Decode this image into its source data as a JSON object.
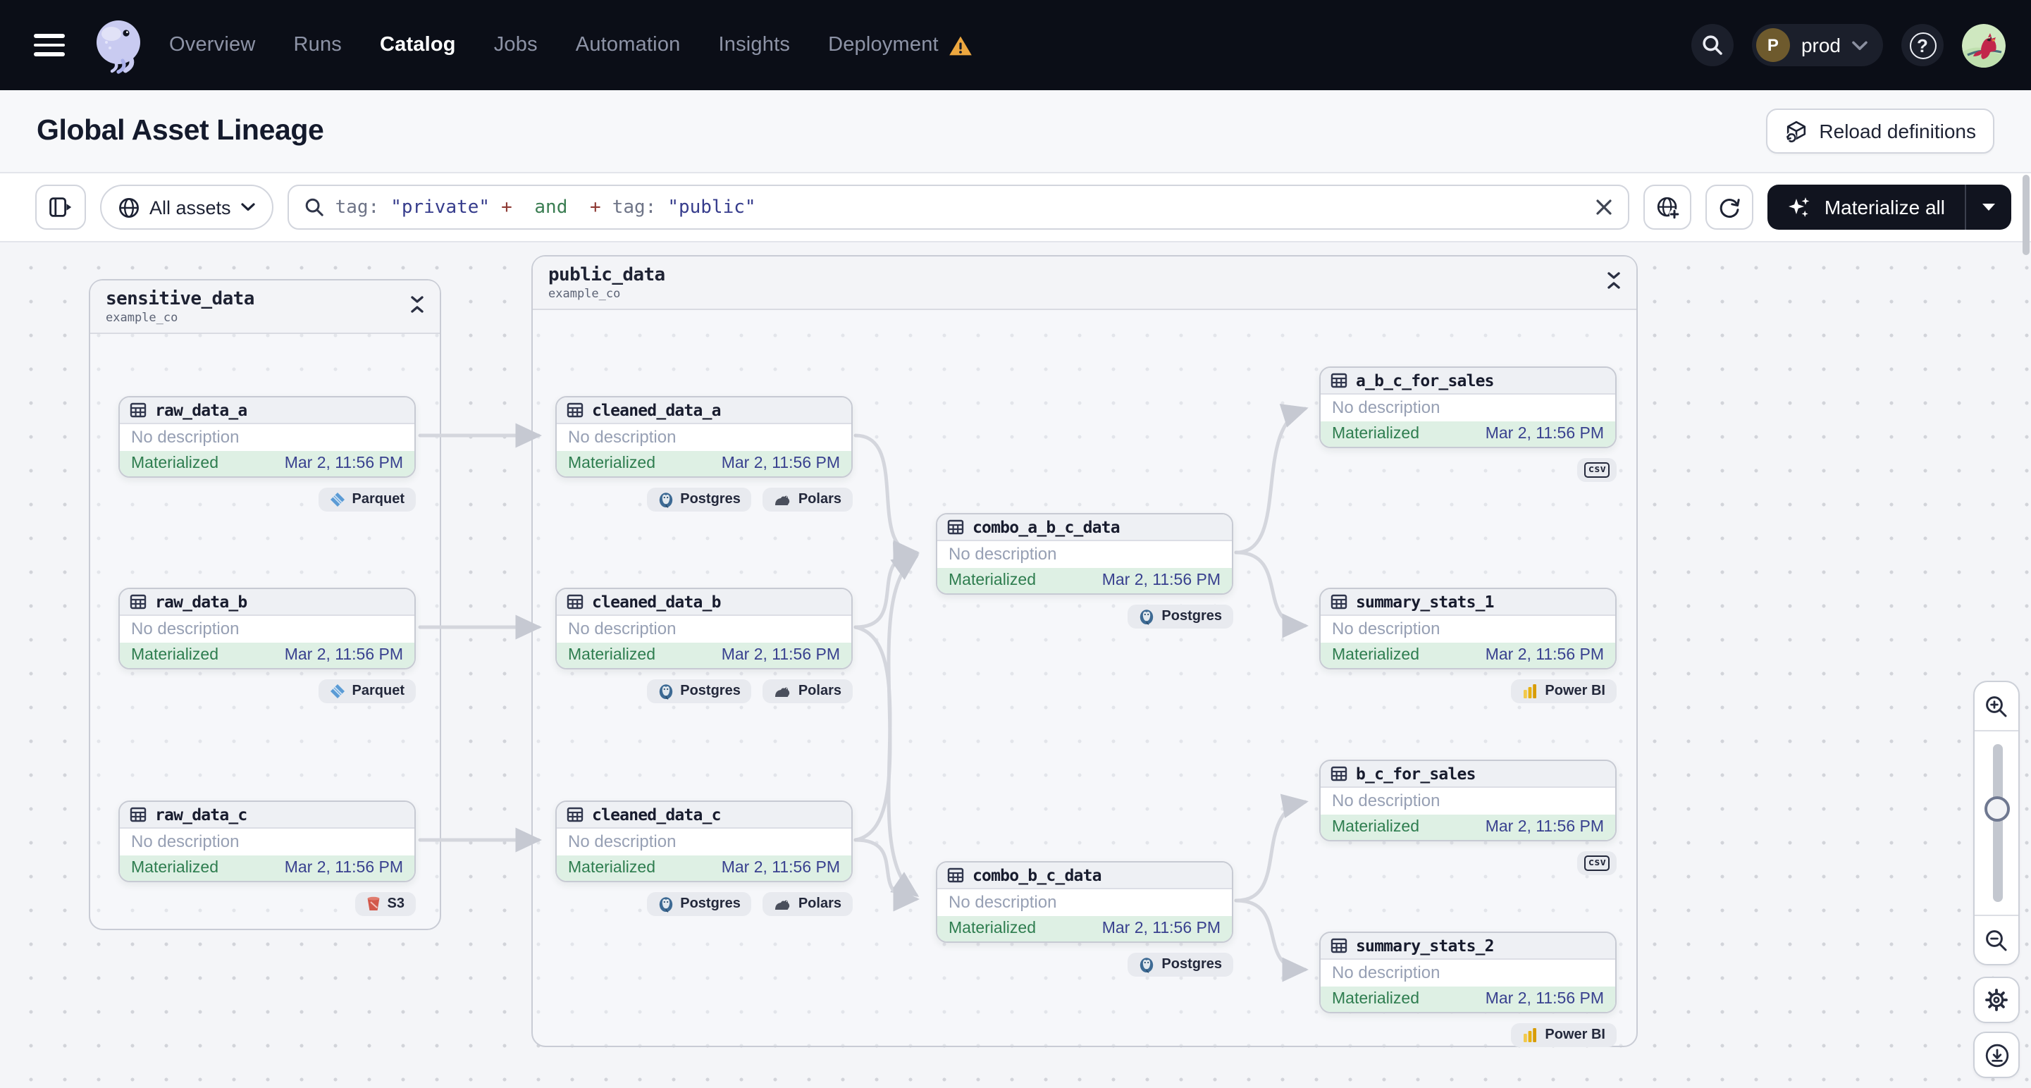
{
  "nav": {
    "items": [
      {
        "label": "Overview"
      },
      {
        "label": "Runs"
      },
      {
        "label": "Catalog",
        "active": true
      },
      {
        "label": "Jobs"
      },
      {
        "label": "Automation"
      },
      {
        "label": "Insights"
      },
      {
        "label": "Deployment",
        "warning": true
      }
    ],
    "environment": "prod",
    "environment_initial": "P"
  },
  "header": {
    "title": "Global Asset Lineage",
    "reload_button": "Reload definitions"
  },
  "filter_bar": {
    "scope_label": "All assets",
    "query": {
      "tokens": [
        {
          "text": "tag:",
          "type": "field"
        },
        {
          "text": "\"private\"",
          "type": "string"
        },
        {
          "text": "+",
          "type": "operator"
        },
        {
          "text": " and ",
          "type": "keyword"
        },
        {
          "text": "+",
          "type": "operator"
        },
        {
          "text": "tag:",
          "type": "field"
        },
        {
          "text": "\"public\"",
          "type": "string"
        }
      ]
    },
    "materialize_button": "Materialize all"
  },
  "graph": {
    "groups": [
      {
        "name": "sensitive_data",
        "repo": "example_co",
        "assets": [
          {
            "name": "raw_data_a",
            "description": "No description",
            "status": "Materialized",
            "materialized_at": "Mar 2, 11:56 PM",
            "badges": [
              {
                "label": "Parquet",
                "icon": "parquet-icon"
              }
            ]
          },
          {
            "name": "raw_data_b",
            "description": "No description",
            "status": "Materialized",
            "materialized_at": "Mar 2, 11:56 PM",
            "badges": [
              {
                "label": "Parquet",
                "icon": "parquet-icon"
              }
            ]
          },
          {
            "name": "raw_data_c",
            "description": "No description",
            "status": "Materialized",
            "materialized_at": "Mar 2, 11:56 PM",
            "badges": [
              {
                "label": "S3",
                "icon": "s3-icon"
              }
            ]
          }
        ]
      },
      {
        "name": "public_data",
        "repo": "example_co",
        "assets": [
          {
            "name": "cleaned_data_a",
            "description": "No description",
            "status": "Materialized",
            "materialized_at": "Mar 2, 11:56 PM",
            "badges": [
              {
                "label": "Postgres",
                "icon": "postgres-icon"
              },
              {
                "label": "Polars",
                "icon": "polars-icon"
              }
            ]
          },
          {
            "name": "cleaned_data_b",
            "description": "No description",
            "status": "Materialized",
            "materialized_at": "Mar 2, 11:56 PM",
            "badges": [
              {
                "label": "Postgres",
                "icon": "postgres-icon"
              },
              {
                "label": "Polars",
                "icon": "polars-icon"
              }
            ]
          },
          {
            "name": "cleaned_data_c",
            "description": "No description",
            "status": "Materialized",
            "materialized_at": "Mar 2, 11:56 PM",
            "badges": [
              {
                "label": "Postgres",
                "icon": "postgres-icon"
              },
              {
                "label": "Polars",
                "icon": "polars-icon"
              }
            ]
          },
          {
            "name": "combo_a_b_c_data",
            "description": "No description",
            "status": "Materialized",
            "materialized_at": "Mar 2, 11:56 PM",
            "badges": [
              {
                "label": "Postgres",
                "icon": "postgres-icon"
              }
            ]
          },
          {
            "name": "combo_b_c_data",
            "description": "No description",
            "status": "Materialized",
            "materialized_at": "Mar 2, 11:56 PM",
            "badges": [
              {
                "label": "Postgres",
                "icon": "postgres-icon"
              }
            ]
          },
          {
            "name": "a_b_c_for_sales",
            "description": "No description",
            "status": "Materialized",
            "materialized_at": "Mar 2, 11:56 PM",
            "badges": [
              {
                "label": "csv",
                "icon": "csv-icon"
              }
            ]
          },
          {
            "name": "summary_stats_1",
            "description": "No description",
            "status": "Materialized",
            "materialized_at": "Mar 2, 11:56 PM",
            "badges": [
              {
                "label": "Power BI",
                "icon": "powerbi-icon"
              }
            ]
          },
          {
            "name": "b_c_for_sales",
            "description": "No description",
            "status": "Materialized",
            "materialized_at": "Mar 2, 11:56 PM",
            "badges": [
              {
                "label": "csv",
                "icon": "csv-icon"
              }
            ]
          },
          {
            "name": "summary_stats_2",
            "description": "No description",
            "status": "Materialized",
            "materialized_at": "Mar 2, 11:56 PM",
            "badges": [
              {
                "label": "Power BI",
                "icon": "powerbi-icon"
              }
            ]
          }
        ]
      }
    ],
    "edges": [
      [
        "raw_data_a",
        "cleaned_data_a"
      ],
      [
        "raw_data_b",
        "cleaned_data_b"
      ],
      [
        "raw_data_c",
        "cleaned_data_c"
      ],
      [
        "cleaned_data_a",
        "combo_a_b_c_data"
      ],
      [
        "cleaned_data_b",
        "combo_a_b_c_data"
      ],
      [
        "cleaned_data_c",
        "combo_a_b_c_data"
      ],
      [
        "cleaned_data_b",
        "combo_b_c_data"
      ],
      [
        "cleaned_data_c",
        "combo_b_c_data"
      ],
      [
        "combo_a_b_c_data",
        "a_b_c_for_sales"
      ],
      [
        "combo_a_b_c_data",
        "summary_stats_1"
      ],
      [
        "combo_b_c_data",
        "b_c_for_sales"
      ],
      [
        "combo_b_c_data",
        "summary_stats_2"
      ]
    ]
  },
  "colors": {
    "nav_background": "#0b0e17",
    "dark_button": "#11141f",
    "materialized_background": "#def0e4",
    "materialized_text": "#2e7d4f",
    "timestamp_text": "#39418f",
    "warning": "#eda73f",
    "edge": "#d4d6dd",
    "query_string": "#363c8c",
    "query_operator": "#8e3a34",
    "query_keyword": "#3a7d52"
  }
}
